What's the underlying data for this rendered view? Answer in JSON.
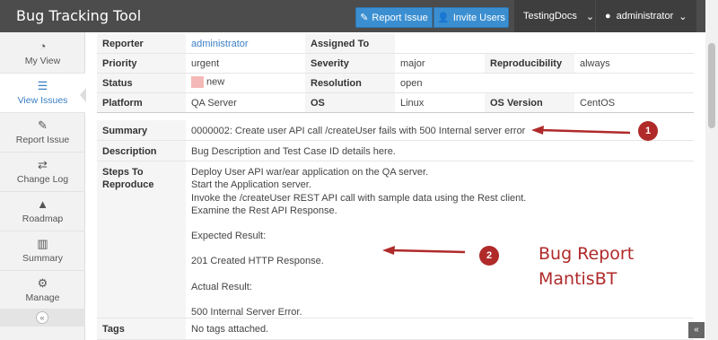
{
  "header": {
    "title": "Bug Tracking Tool",
    "report_issue": "Report Issue",
    "invite_users": "Invite Users",
    "project": "TestingDocs",
    "user": "administrator"
  },
  "sidebar": {
    "items": [
      {
        "label": "My View",
        "icon": "dashboard-icon"
      },
      {
        "label": "View Issues",
        "icon": "list-icon"
      },
      {
        "label": "Report Issue",
        "icon": "edit-icon"
      },
      {
        "label": "Change Log",
        "icon": "retweet-icon"
      },
      {
        "label": "Roadmap",
        "icon": "road-icon"
      },
      {
        "label": "Summary",
        "icon": "bar-chart-icon"
      },
      {
        "label": "Manage",
        "icon": "cogs-icon"
      }
    ],
    "active": "View Issues",
    "collapse_glyph": "«"
  },
  "issue": {
    "reporter_label": "Reporter",
    "reporter": "administrator",
    "assigned_label": "Assigned To",
    "assigned": "",
    "priority_label": "Priority",
    "priority": "urgent",
    "severity_label": "Severity",
    "severity": "major",
    "reproducibility_label": "Reproducibility",
    "reproducibility": "always",
    "status_label": "Status",
    "status": "new",
    "status_color": "#f5b8b8",
    "resolution_label": "Resolution",
    "resolution": "open",
    "platform_label": "Platform",
    "platform": "QA Server",
    "os_label": "OS",
    "os": "Linux",
    "os_version_label": "OS Version",
    "os_version": "CentOS",
    "summary_label": "Summary",
    "summary": "0000002: Create user API call /createUser fails with 500 Internal server error",
    "description_label": "Description",
    "description": "Bug Description and Test Case ID details here.",
    "steps_label_1": "Steps To",
    "steps_label_2": "Reproduce",
    "steps": [
      "Deploy User API war/ear application on the QA server.",
      "Start the Application server.",
      "Invoke the /createUser REST API call with sample data using the Rest client.",
      "Examine the Rest API Response."
    ],
    "expected_label": "Expected Result:",
    "expected": "201 Created HTTP Response.",
    "actual_label": "Actual Result:",
    "actual": "500 Internal Server Error.",
    "tags_label": "Tags",
    "tags": "No tags attached."
  },
  "annotations": {
    "marker_1": "1",
    "marker_2": "2",
    "caption_line1": "Bug Report",
    "caption_line2": "MantisBT",
    "color": "#b02a2a"
  },
  "scroll_to_top": "«"
}
